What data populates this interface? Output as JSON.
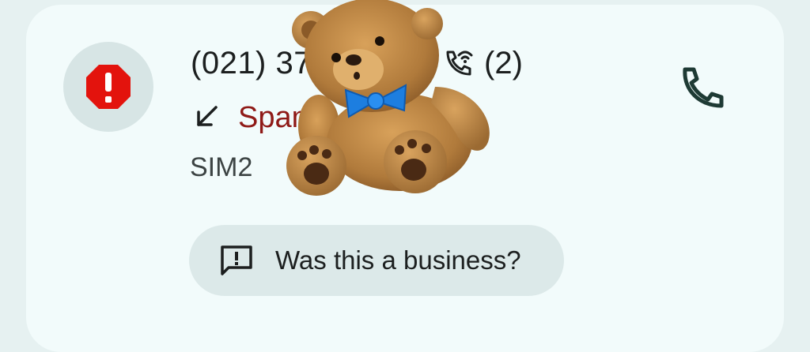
{
  "call": {
    "number": "(021) 37",
    "count": "(2)",
    "status": "Spam",
    "sim": "SIM2"
  },
  "icons": {
    "avatar": "spam-warning-icon",
    "call_type": "wifi-call-icon",
    "direction": "incoming-arrow-icon",
    "action": "phone-icon",
    "chip": "feedback-icon",
    "sticker": "teddy-bear-sticker"
  },
  "chip": {
    "label": "Was this a business?"
  },
  "colors": {
    "background": "#e6f1f1",
    "card": "#f2fbfb",
    "spam_text": "#8f1a17",
    "spam_badge": "#e3130d",
    "accent_dark": "#1e3a34"
  }
}
